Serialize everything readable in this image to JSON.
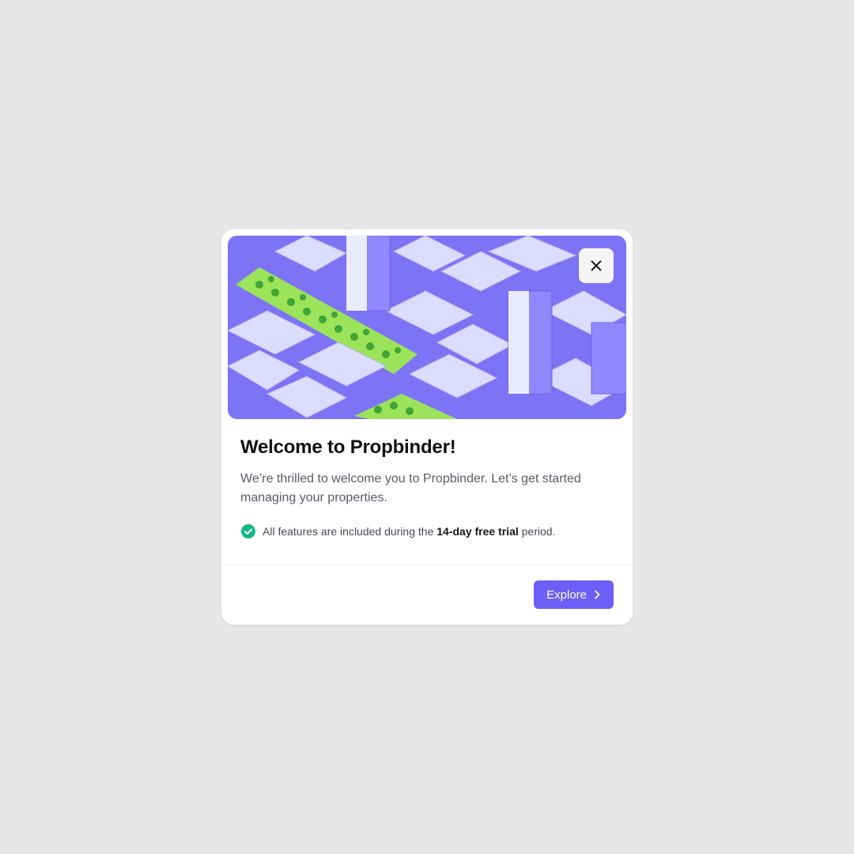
{
  "modal": {
    "close_icon": "close-icon",
    "hero_image": "isometric-city-illustration",
    "title": "Welcome to Propbinder!",
    "description": "We’re thrilled to welcome you to Propbinder. Let’s get started managing your properties.",
    "feature": {
      "icon": "check-circle-icon",
      "text_before": "All features are included during the ",
      "text_bold": "14-day free trial",
      "text_after": " period."
    },
    "explore_button": {
      "label": "Explore",
      "icon": "chevron-right-icon"
    }
  },
  "colors": {
    "background": "#e7e7e7",
    "accent": "#6c5ff6",
    "success": "#12b886",
    "hero": "#7c74f4"
  }
}
